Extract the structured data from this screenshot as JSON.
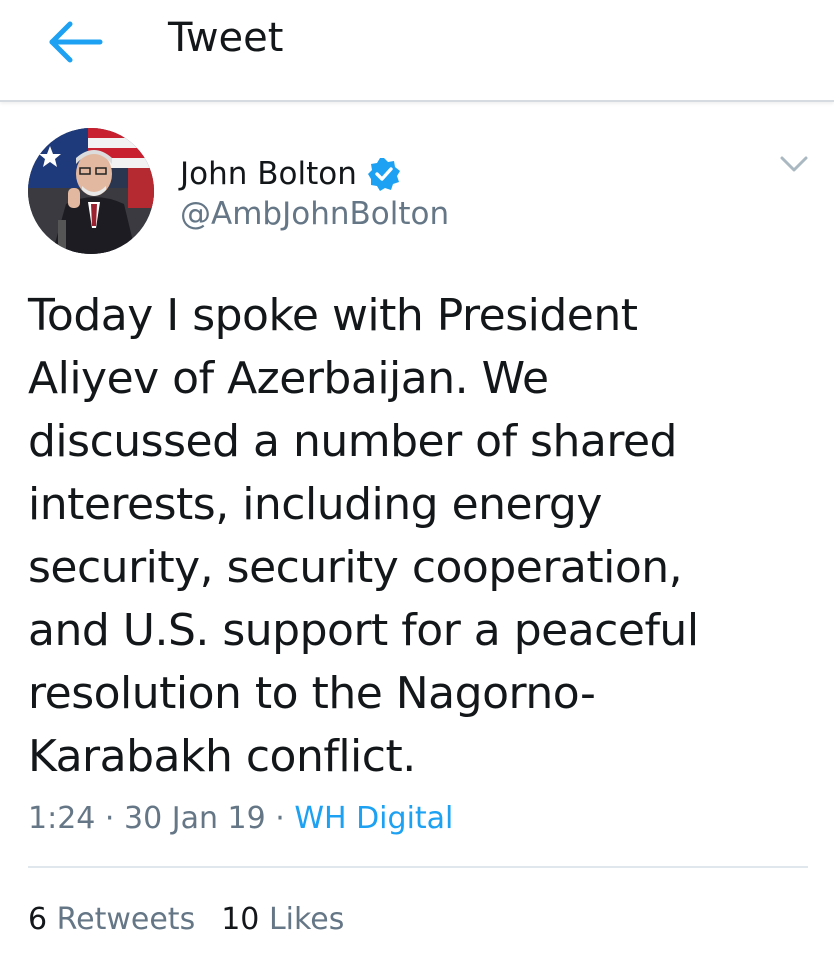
{
  "header": {
    "title": "Tweet",
    "back_icon": "arrow-left-icon"
  },
  "tweet": {
    "author": {
      "display_name": "John Bolton",
      "handle": "@AmbJohnBolton",
      "verified": true,
      "avatar_icon": "avatar-photo"
    },
    "text": "Today I spoke with President\nAliyev of Azerbaijan.  We\ndiscussed a number of shared\ninterests, including energy\nsecurity, security cooperation,\nand U.S. support for a peaceful\nresolution to the Nagorno-\nKarabakh conflict.",
    "time": "1:24",
    "date": "30 Jan 19",
    "separator": "·",
    "source": "WH Digital",
    "stats": {
      "retweets_count": "6",
      "retweets_label": "Retweets",
      "likes_count": "10",
      "likes_label": "Likes"
    }
  },
  "colors": {
    "accent": "#1da1f2",
    "text_primary": "#14171a",
    "text_secondary": "#657786",
    "divider": "#e1e8ed"
  }
}
